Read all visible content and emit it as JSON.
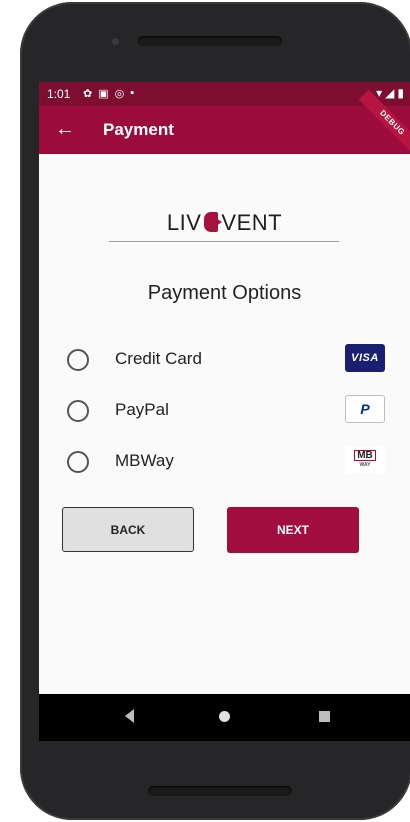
{
  "status_bar": {
    "time": "1:01",
    "icons": [
      "gear-icon",
      "image-icon",
      "at-icon",
      "sd-card-icon"
    ],
    "right_icons": [
      "wifi-icon",
      "signal-icon",
      "battery-icon"
    ]
  },
  "app_bar": {
    "title": "Payment",
    "back_icon": "arrow-left-icon",
    "debug": "DEBUG"
  },
  "logo": {
    "left": "LIV",
    "right": "VENT"
  },
  "page": {
    "title": "Payment Options"
  },
  "options": [
    {
      "label": "Credit Card",
      "badge": "VISA"
    },
    {
      "label": "PayPal",
      "badge": "P"
    },
    {
      "label": "MBWay",
      "badge": "MB",
      "badge_sub": "WAY"
    }
  ],
  "buttons": {
    "back": "BACK",
    "next": "NEXT"
  },
  "colors": {
    "primary": "#9b0b3c",
    "status": "#7d0e32",
    "button": "#a10d3e"
  }
}
